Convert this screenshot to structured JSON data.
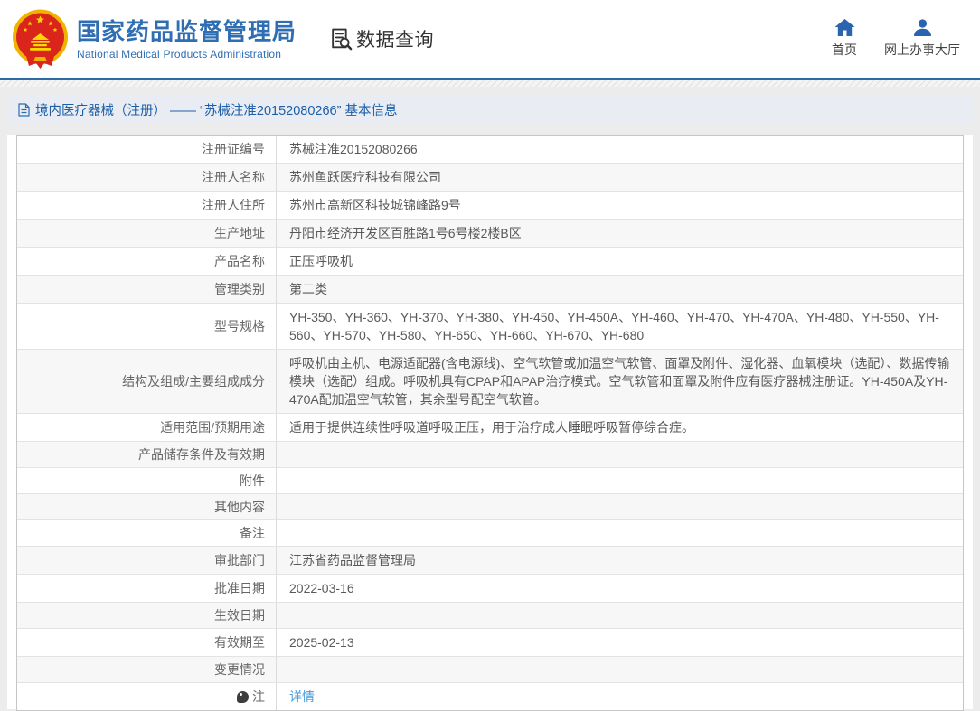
{
  "header": {
    "title_cn": "国家药品监督管理局",
    "title_en": "National Medical Products Administration",
    "data_query_label": "数据查询",
    "nav": [
      {
        "label": "首页",
        "icon": "home-icon"
      },
      {
        "label": "网上办事大厅",
        "icon": "user-icon"
      }
    ],
    "logo_icon": "national-emblem-icon",
    "data_query_icon": "document-search-icon"
  },
  "breadcrumb": {
    "icon": "document-icon",
    "text": "境内医疗器械（注册） —— “苏械注准20152080266” 基本信息"
  },
  "table": {
    "rows": [
      {
        "label": "注册证编号",
        "value": "苏械注准20152080266"
      },
      {
        "label": "注册人名称",
        "value": "苏州鱼跃医疗科技有限公司"
      },
      {
        "label": "注册人住所",
        "value": "苏州市高新区科技城锦峰路9号"
      },
      {
        "label": "生产地址",
        "value": "丹阳市经济开发区百胜路1号6号楼2楼B区"
      },
      {
        "label": "产品名称",
        "value": "正压呼吸机"
      },
      {
        "label": "管理类别",
        "value": "第二类"
      },
      {
        "label": "型号规格",
        "value": "YH-350、YH-360、YH-370、YH-380、YH-450、YH-450A、YH-460、YH-470、YH-470A、YH-480、YH-550、YH-560、YH-570、YH-580、YH-650、YH-660、YH-670、YH-680"
      },
      {
        "label": "结构及组成/主要组成成分",
        "value": "呼吸机由主机、电源适配器(含电源线)、空气软管或加温空气软管、面罩及附件、湿化器、血氧模块（选配）、数据传输模块（选配）组成。呼吸机具有CPAP和APAP治疗模式。空气软管和面罩及附件应有医疗器械注册证。YH-450A及YH-470A配加温空气软管，其余型号配空气软管。"
      },
      {
        "label": "适用范围/预期用途",
        "value": "适用于提供连续性呼吸道呼吸正压，用于治疗成人睡眠呼吸暂停综合症。"
      },
      {
        "label": "产品储存条件及有效期",
        "value": ""
      },
      {
        "label": "附件",
        "value": ""
      },
      {
        "label": "其他内容",
        "value": ""
      },
      {
        "label": "备注",
        "value": ""
      },
      {
        "label": "审批部门",
        "value": "江苏省药品监督管理局"
      },
      {
        "label": "批准日期",
        "value": "2022-03-16"
      },
      {
        "label": "生效日期",
        "value": ""
      },
      {
        "label": "有效期至",
        "value": "2025-02-13"
      },
      {
        "label": "变更情况",
        "value": ""
      },
      {
        "label": "注",
        "icon": "note-balloon-icon",
        "link": "详情"
      }
    ]
  },
  "colors": {
    "accent_blue": "#2f6eb2",
    "icon_blue": "#2a63ae",
    "link_blue": "#4a9bdc",
    "breadcrumb_text": "#1c5fa8",
    "header_border": "#2e6da4",
    "emblem_red": "#da251c",
    "emblem_gold": "#f5c51d",
    "row_alt_bg": "#f7f7f7"
  }
}
